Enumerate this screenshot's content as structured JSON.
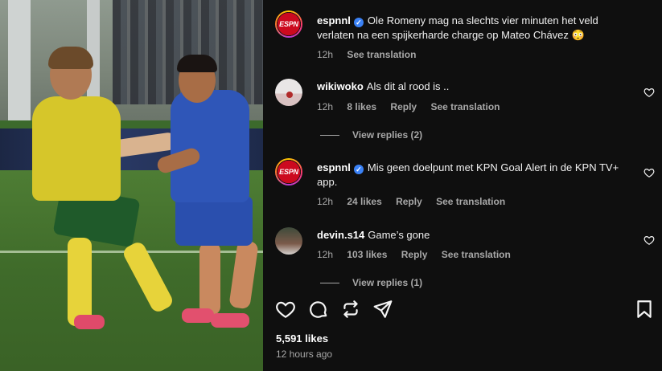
{
  "post": {
    "likes": "5,591 likes",
    "time": "12 hours ago"
  },
  "comments": [
    {
      "username": "espnnl",
      "verified": true,
      "text": "Ole Romeny mag na slechts vier minuten het veld verlaten na een spijkerharde charge op Mateo Chávez 😳",
      "time": "12h",
      "likes": "",
      "reply": "",
      "translate": "See translation"
    },
    {
      "username": "wikiwoko",
      "verified": false,
      "text": "Als dit al rood is ..",
      "time": "12h",
      "likes": "8 likes",
      "reply": "Reply",
      "translate": "See translation",
      "view_replies": "View replies (2)"
    },
    {
      "username": "espnnl",
      "verified": true,
      "text": "Mis geen doelpunt met KPN Goal Alert in de KPN TV+ app.",
      "time": "12h",
      "likes": "24 likes",
      "reply": "Reply",
      "translate": "See translation"
    },
    {
      "username": "devin.s14",
      "verified": false,
      "text": "Game’s gone",
      "time": "12h",
      "likes": "103 likes",
      "reply": "Reply",
      "translate": "See translation",
      "view_replies": "View replies (1)"
    }
  ],
  "avatars": {
    "espn_label": "ESPN"
  },
  "icons": {
    "like": "heart-icon",
    "comment": "comment-icon",
    "repost": "repost-icon",
    "share": "send-icon",
    "save": "bookmark-icon"
  }
}
